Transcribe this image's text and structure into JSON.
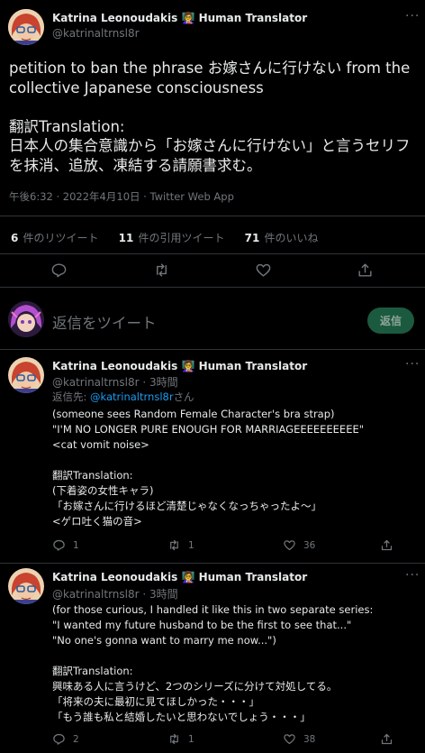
{
  "main_tweet": {
    "author_name": "Katrina Leonoudakis 👩‍🏫 Human Translator",
    "handle": "@katrinaltrnsl8r",
    "text": "petition to ban the phrase お嫁さんに行けない from the collective Japanese consciousness\n\n翻訳Translation:\n日本人の集合意識から「お嫁さんに行けない」と言うセリフを抹消、追放、凍結する請願書求む。",
    "timestamp": "午後6:32 · 2022年4月10日 · Twitter Web App",
    "retweets_count": "6",
    "retweets_label": "件のリツイート",
    "quotes_count": "11",
    "quotes_label": "件の引用ツイート",
    "likes_count": "71",
    "likes_label": "件のいいね"
  },
  "compose": {
    "placeholder": "返信をツイート",
    "reply_button": "返信"
  },
  "replies": [
    {
      "author_name": "Katrina Leonoudakis 👩‍🏫 Human Translator",
      "handle_time": "@katrinaltrnsl8r · 3時間",
      "reply_to_prefix": "返信先: ",
      "reply_to_handle": "@katrinaltrnsl8r",
      "reply_to_suffix": "さん",
      "text": "(someone sees Random Female Character's bra strap)\n\"I'M NO LONGER PURE ENOUGH FOR MARRIAGEEEEEEEEEE\"\n<cat vomit noise>\n\n翻訳Translation:\n(下着姿の女性キャラ)\n「お嫁さんに行けるほど清楚じゃなくなっちゃったよ〜」\n<ゲロ吐く猫の音>",
      "replies_count": "1",
      "retweets_count": "1",
      "likes_count": "36"
    },
    {
      "author_name": "Katrina Leonoudakis 👩‍🏫 Human Translator",
      "handle_time": "@katrinaltrnsl8r · 3時間",
      "text": "(for those curious, I handled it like this in two separate series:\n\"I wanted my future husband to be the first to see that...\"\n\"No one's gonna want to marry me now...\")\n\n翻訳Translation:\n興味ある人に言うけど、2つのシリーズに分けて対処してる。\n「将来の夫に最初に見てほしかった・・・」\n「もう誰も私と結婚したいと思わないでしょう・・・」",
      "replies_count": "2",
      "retweets_count": "1",
      "likes_count": "38"
    }
  ]
}
